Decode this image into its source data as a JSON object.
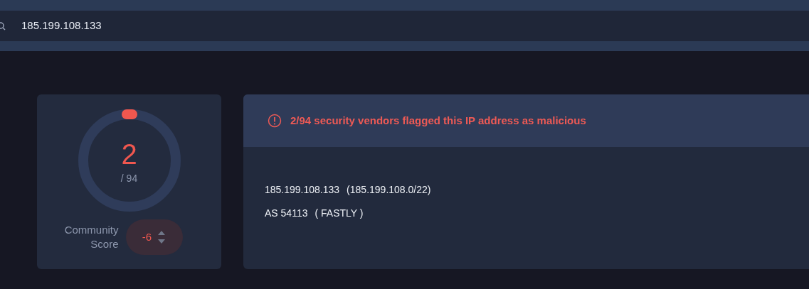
{
  "search": {
    "value": "185.199.108.133"
  },
  "detections": {
    "count": "2",
    "total": "/ 94",
    "community_label": "Community Score",
    "community_score": "-6"
  },
  "alert": {
    "text": "2/94 security vendors flagged this IP address as malicious"
  },
  "details": [
    {
      "main": "185.199.108.133",
      "extra": "(185.199.108.0/22)"
    },
    {
      "main": "AS 54113",
      "extra": "( FASTLY )"
    }
  ]
}
